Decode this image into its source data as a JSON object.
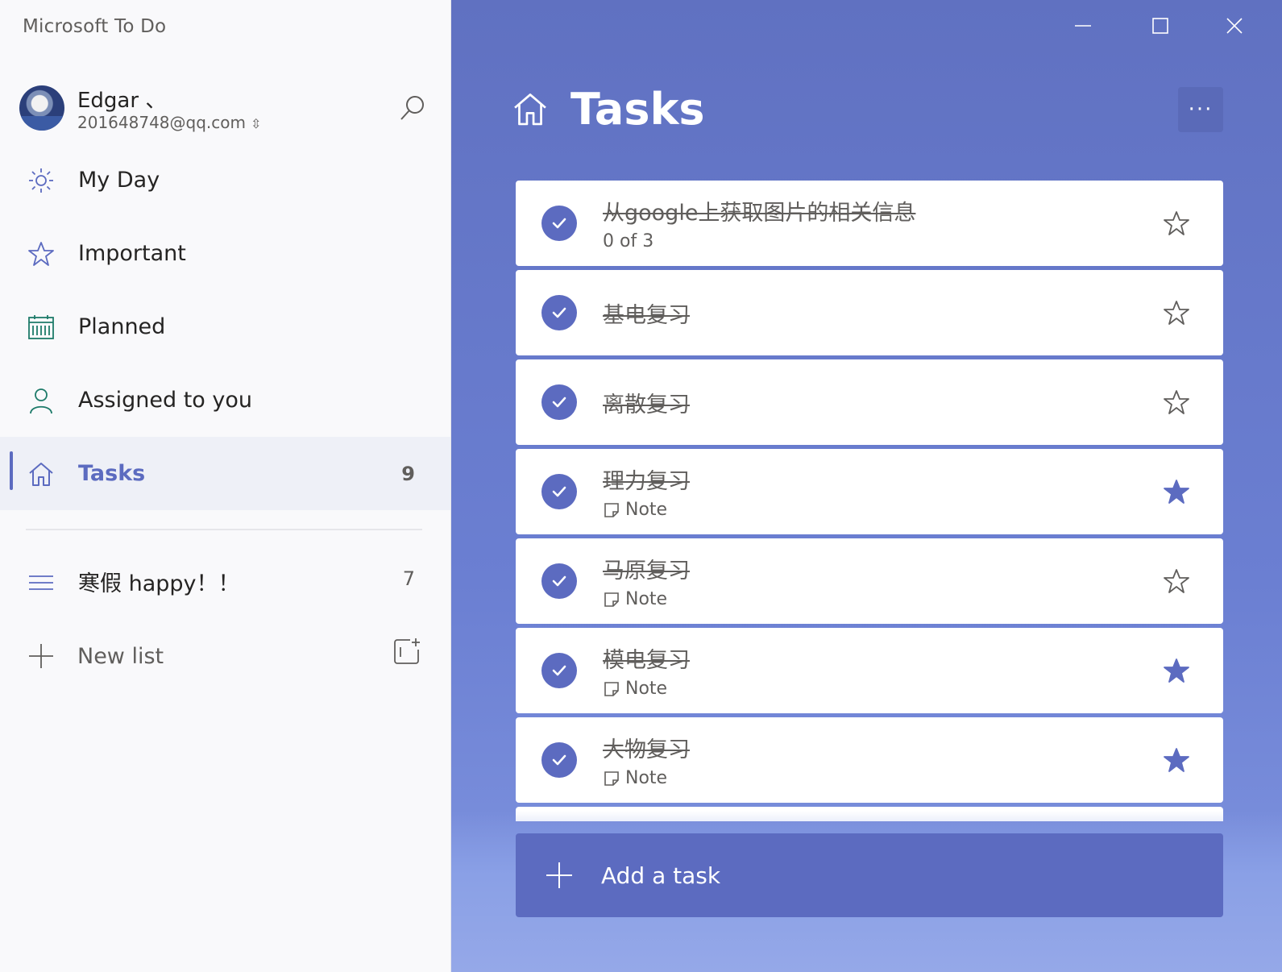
{
  "app": {
    "title": "Microsoft To Do"
  },
  "profile": {
    "name": "Edgar 、",
    "email": "201648748@qq.com"
  },
  "nav": {
    "items": [
      {
        "label": "My Day",
        "icon": "sun-icon"
      },
      {
        "label": "Important",
        "icon": "star-icon"
      },
      {
        "label": "Planned",
        "icon": "calendar-icon"
      },
      {
        "label": "Assigned to you",
        "icon": "person-icon"
      },
      {
        "label": "Tasks",
        "icon": "home-icon",
        "count": "9",
        "active": true
      }
    ]
  },
  "lists": [
    {
      "label": "寒假 happy！！",
      "icon": "list-icon",
      "count": "7"
    }
  ],
  "new_list": {
    "label": "New list"
  },
  "main": {
    "title": "Tasks",
    "more_label": "···",
    "tasks": [
      {
        "title": "从google上获取图片的相关信息",
        "meta": "0 of 3",
        "meta_type": "steps",
        "completed": true,
        "important": false
      },
      {
        "title": "基电复习",
        "meta": "",
        "completed": true,
        "important": false
      },
      {
        "title": "离散复习",
        "meta": "",
        "completed": true,
        "important": false
      },
      {
        "title": "理力复习",
        "meta": "Note",
        "meta_type": "note",
        "completed": true,
        "important": true
      },
      {
        "title": "马原复习",
        "meta": "Note",
        "meta_type": "note",
        "completed": true,
        "important": false
      },
      {
        "title": "模电复习",
        "meta": "Note",
        "meta_type": "note",
        "completed": true,
        "important": true
      },
      {
        "title": "大物复习",
        "meta": "Note",
        "meta_type": "note",
        "completed": true,
        "important": true
      }
    ],
    "add_task_label": "Add a task"
  },
  "colors": {
    "accent": "#5c6bc0",
    "background": "#6b7fd2",
    "sidebar": "#f9f9fb"
  }
}
